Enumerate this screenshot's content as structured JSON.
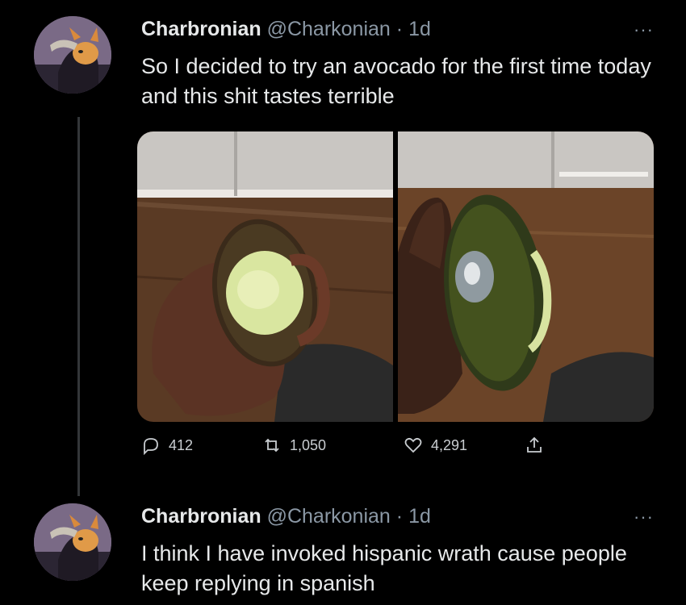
{
  "tweets": [
    {
      "name": "Charbronian",
      "handle": "@Charkonian",
      "separator": "·",
      "time": "1d",
      "more": "···",
      "text": "So I decided to try an avocado for the first time today and this shit tastes terrible",
      "stats": {
        "replies": "412",
        "retweets": "1,050",
        "likes": "4,291"
      }
    },
    {
      "name": "Charbronian",
      "handle": "@Charkonian",
      "separator": "·",
      "time": "1d",
      "more": "···",
      "text": "I think I have invoked hispanic wrath cause people keep replying in spanish"
    }
  ],
  "colors": {
    "background": "#000000",
    "text": "#e7e9ea",
    "secondary": "#8b98a5",
    "thread_line": "#333639"
  },
  "icons": [
    "reply-icon",
    "retweet-icon",
    "like-icon",
    "share-icon",
    "more-icon"
  ]
}
